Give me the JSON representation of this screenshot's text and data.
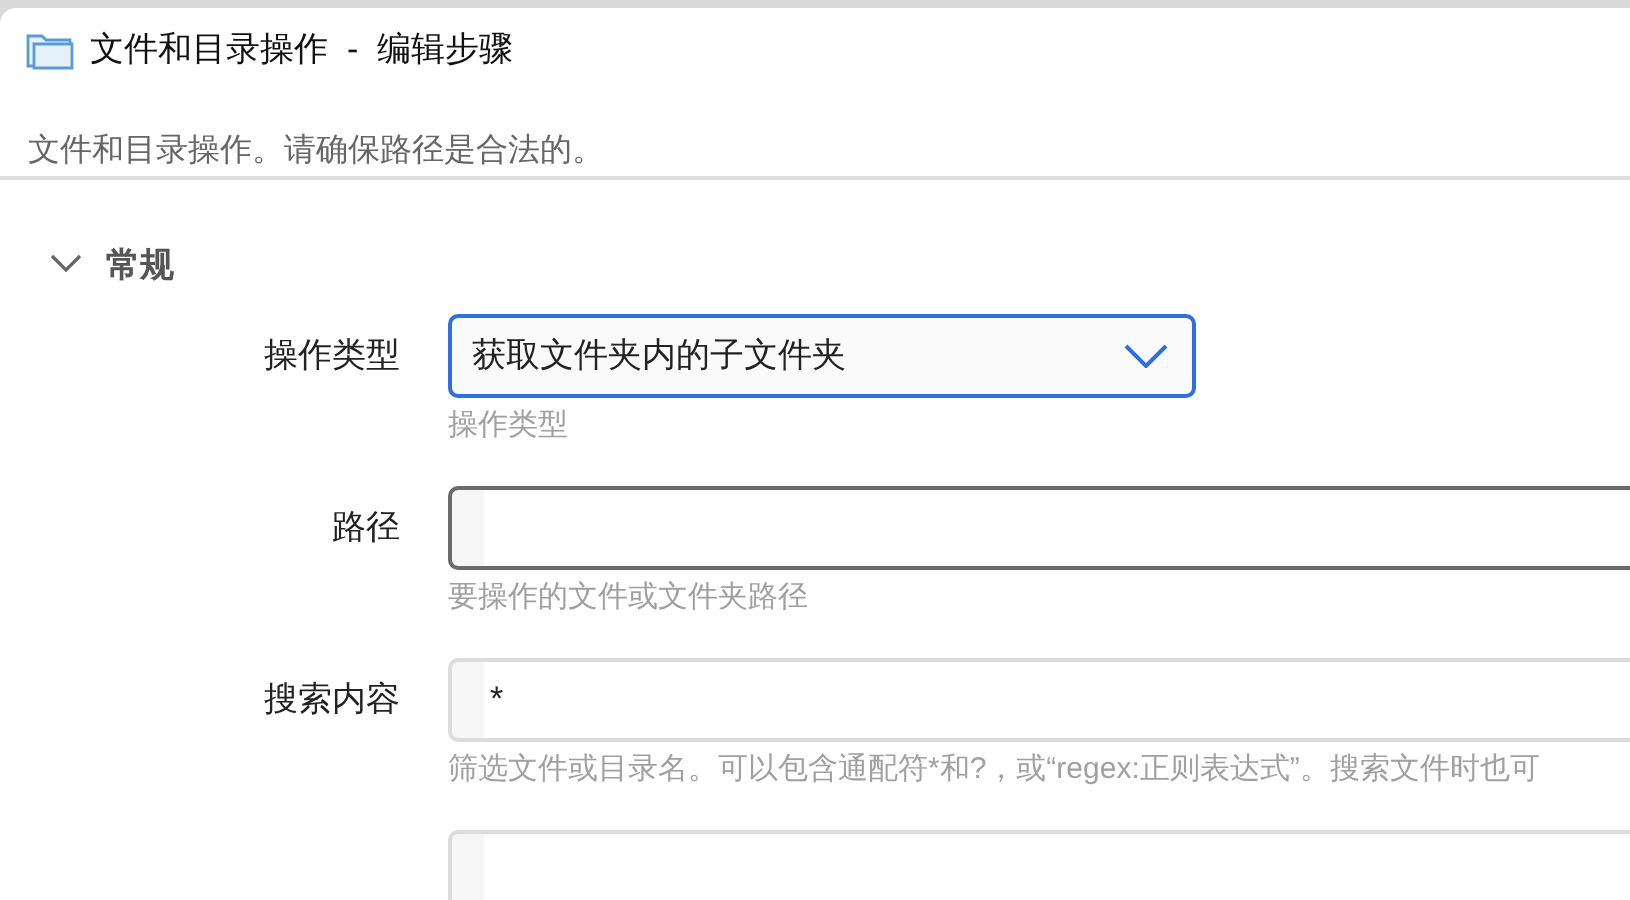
{
  "window": {
    "title": "文件和目录操作  -  编辑步骤"
  },
  "description": "文件和目录操作。请确保路径是合法的。",
  "section": {
    "title": "常规",
    "expanded": true
  },
  "fields": [
    {
      "kind": "select",
      "label": "操作类型",
      "value": "获取文件夹内的子文件夹",
      "hint": "操作类型",
      "focused": true
    },
    {
      "kind": "text",
      "label": "路径",
      "hint": "要操作的文件或文件夹路径",
      "focused": false,
      "hover": true
    },
    {
      "kind": "text",
      "label": "搜索内容",
      "value": "*",
      "hint": "筛选文件或目录名。可以包含通配符*和?，或“regex:正则表达式”。搜索文件时也可",
      "focused": false,
      "hover": false
    },
    {
      "kind": "text",
      "focused": false,
      "hover": false
    }
  ]
}
